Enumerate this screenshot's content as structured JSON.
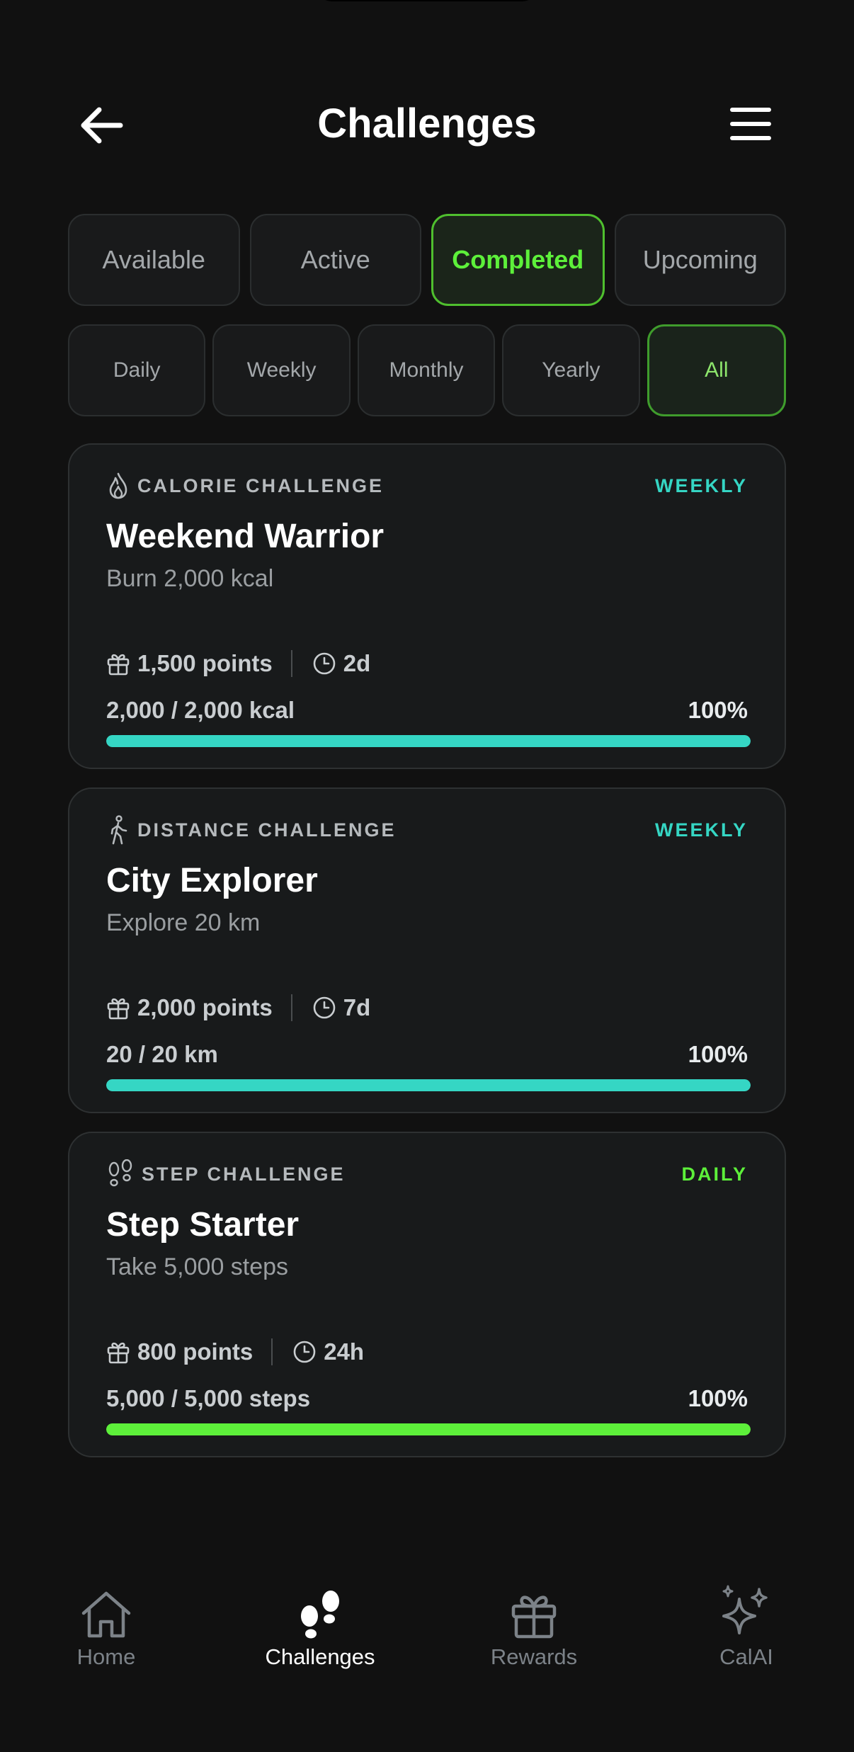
{
  "header": {
    "title": "Challenges"
  },
  "tabs": [
    {
      "label": "Available",
      "active": false
    },
    {
      "label": "Active",
      "active": false
    },
    {
      "label": "Completed",
      "active": true
    },
    {
      "label": "Upcoming",
      "active": false
    }
  ],
  "periods": [
    {
      "label": "Daily",
      "active": false
    },
    {
      "label": "Weekly",
      "active": false
    },
    {
      "label": "Monthly",
      "active": false
    },
    {
      "label": "Yearly",
      "active": false
    },
    {
      "label": "All",
      "active": true
    }
  ],
  "cards": [
    {
      "type_label": "CALORIE CHALLENGE",
      "type_icon": "flame-icon",
      "period": "WEEKLY",
      "period_color": "#35d6c4",
      "title": "Weekend Warrior",
      "subtitle": "Burn 2,000 kcal",
      "points": "1,500 points",
      "duration": "2d",
      "progress_text": "2,000 / 2,000 kcal",
      "progress_pct": "100%",
      "progress_fraction": 1.0,
      "bar_color": "#35d6c4"
    },
    {
      "type_label": "DISTANCE CHALLENGE",
      "type_icon": "walking-person-icon",
      "period": "WEEKLY",
      "period_color": "#35d6c4",
      "title": "City Explorer",
      "subtitle": "Explore 20 km",
      "points": "2,000 points",
      "duration": "7d",
      "progress_text": "20 / 20 km",
      "progress_pct": "100%",
      "progress_fraction": 1.0,
      "bar_color": "#35d6c4"
    },
    {
      "type_label": "STEP CHALLENGE",
      "type_icon": "footprints-icon",
      "period": "DAILY",
      "period_color": "#5df03a",
      "title": "Step Starter",
      "subtitle": "Take 5,000 steps",
      "points": "800 points",
      "duration": "24h",
      "progress_text": "5,000 / 5,000 steps",
      "progress_pct": "100%",
      "progress_fraction": 1.0,
      "bar_color": "#5df03a"
    }
  ],
  "nav": [
    {
      "label": "Home",
      "icon": "home-icon",
      "active": false
    },
    {
      "label": "Challenges",
      "icon": "footprints-icon",
      "active": true
    },
    {
      "label": "Rewards",
      "icon": "gift-icon",
      "active": false
    },
    {
      "label": "CalAI",
      "icon": "sparkles-icon",
      "active": false
    }
  ],
  "colors": {
    "background": "#111111",
    "accent_green": "#5df03a",
    "accent_teal": "#35d6c4"
  }
}
